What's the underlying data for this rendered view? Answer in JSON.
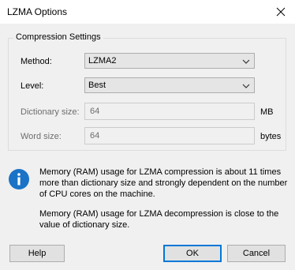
{
  "window": {
    "title": "LZMA Options"
  },
  "group": {
    "title": "Compression Settings"
  },
  "fields": {
    "method": {
      "label": "Method:",
      "value": "LZMA2"
    },
    "level": {
      "label": "Level:",
      "value": "Best"
    },
    "dictionary_size": {
      "label": "Dictionary size:",
      "value": "64",
      "unit": "MB"
    },
    "word_size": {
      "label": "Word size:",
      "value": "64",
      "unit": "bytes"
    }
  },
  "info": {
    "icon": "info-icon",
    "compression_line1": "Memory (RAM) usage for LZMA compression is about 11 times",
    "compression_line2": "more than dictionary size and strongly dependent on the number",
    "compression_line3": "of CPU cores on the machine.",
    "decompression_line1": "Memory (RAM) usage for LZMA decompression is close to the",
    "decompression_line2": "value of dictionary size."
  },
  "buttons": {
    "help": "Help",
    "ok": "OK",
    "cancel": "Cancel"
  },
  "colors": {
    "accent": "#0078d7",
    "info_icon": "#1a73c6"
  }
}
